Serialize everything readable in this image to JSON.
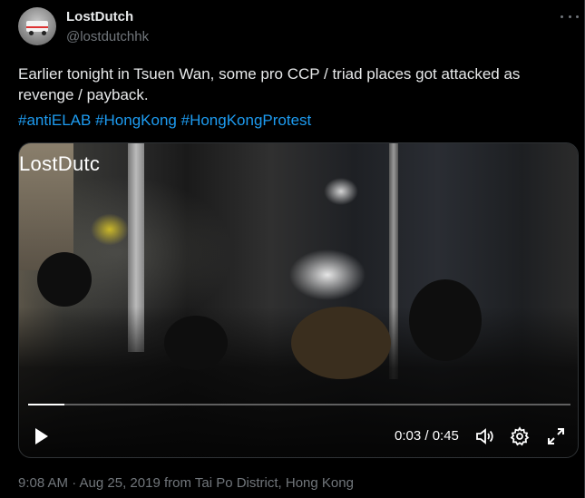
{
  "tweet": {
    "author_name": "LostDutch",
    "author_handle": "@lostdutchhk",
    "text": "Earlier tonight in Tsuen Wan, some pro CCP / triad places got attacked as revenge / payback.",
    "hashtags": [
      "#antiELAB",
      "#HongKong",
      "#HongKongProtest"
    ],
    "timestamp": "9:08 AM · Aug 25, 2019 from Tai Po District, Hong Kong"
  },
  "video": {
    "watermark": "LostDutc",
    "current_time": "0:03",
    "duration": "0:45",
    "time_display": "0:03 / 0:45",
    "progress_fraction": 0.067,
    "controls": [
      "play-icon",
      "volume-icon",
      "gear-icon",
      "fullscreen-icon"
    ]
  },
  "colors": {
    "background": "#000000",
    "text": "#e7e9ea",
    "secondary": "#71767b",
    "link": "#1d9bf0"
  }
}
